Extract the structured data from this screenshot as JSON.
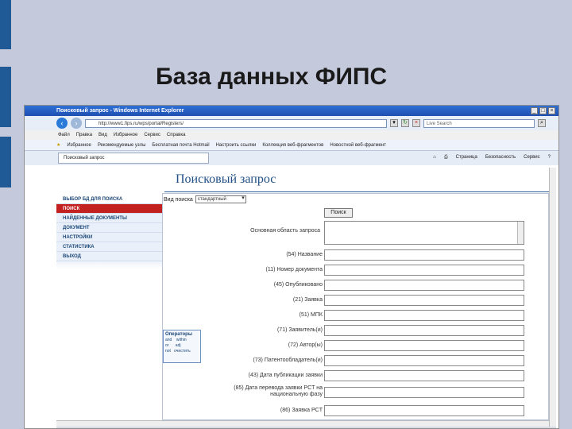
{
  "slide": {
    "title": "База данных ФИПС",
    "bar_color": "#1f5a96"
  },
  "browser": {
    "title": "Поисковый запрос - Windows Internet Explorer",
    "address": "http://www1.fips.ru/wps/portal/Registers/",
    "live_search": "Live Search",
    "menu": [
      "Файл",
      "Правка",
      "Вид",
      "Избранное",
      "Сервис",
      "Справка"
    ],
    "favorites_label": "Избранное",
    "favorites_links": [
      "Рекомендуемые узлы",
      "Бесплатная почта Hotmail",
      "Настроить ссылки",
      "Коллекция веб-фрагментов",
      "Новостной веб-фрагмент"
    ],
    "tab_title": "Поисковый запрос",
    "tools": [
      "Страница",
      "Безопасность",
      "Сервис"
    ]
  },
  "page": {
    "heading": "Поисковый запрос",
    "side_menu": [
      {
        "label": "ВЫБОР БД ДЛЯ ПОИСКА",
        "active": false
      },
      {
        "label": "ПОИСК",
        "active": true
      },
      {
        "label": "НАЙДЕННЫЕ ДОКУМЕНТЫ",
        "active": false
      },
      {
        "label": "ДОКУМЕНТ",
        "active": false
      },
      {
        "label": "НАСТРОЙКИ",
        "active": false
      },
      {
        "label": "СТАТИСТИКА",
        "active": false
      },
      {
        "label": "ВЫХОД",
        "active": false
      }
    ],
    "search_type_label": "Вид поиска",
    "search_type_value": "стандартный",
    "search_button": "Поиск",
    "main_area_label": "Основная область запроса",
    "fields": [
      "(54) Название",
      "(11) Номер документа",
      "(45) Опубликовано",
      "(21) Заявка",
      "(51) МПК",
      "(71) Заявитель(и)",
      "(72) Автор(ы)",
      "(73) Патентообладатель(и)",
      "(43) Дата публикации заявки",
      "(85) Дата перевода заявки PCT на национальную фазу",
      "(86) Заявка PCT"
    ],
    "operators": {
      "title": "Операторы",
      "items": [
        "and",
        "within",
        "or",
        "adj",
        "not",
        "очистить"
      ]
    }
  }
}
